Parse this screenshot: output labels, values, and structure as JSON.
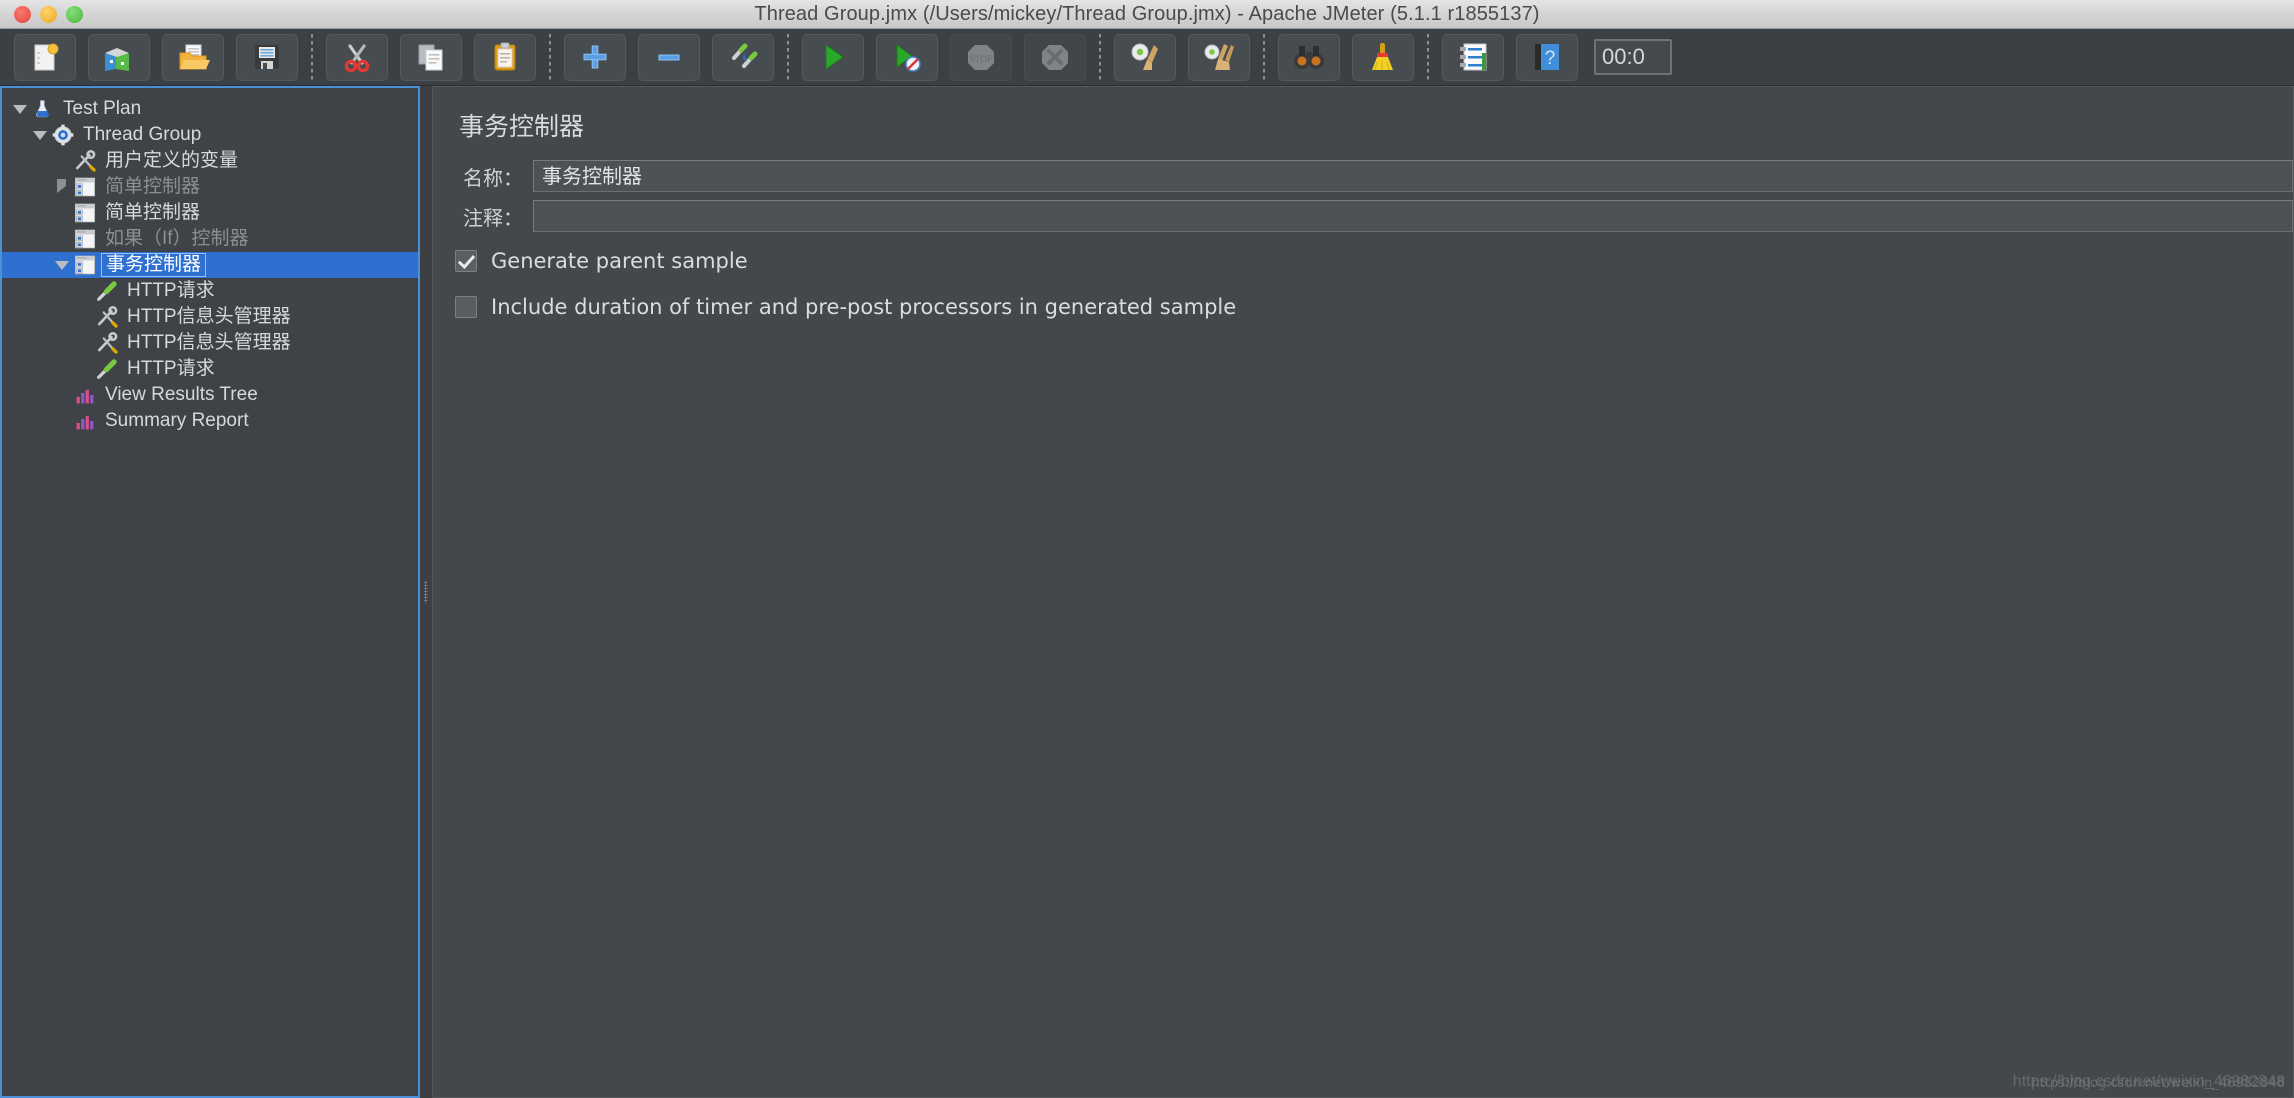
{
  "window": {
    "title": "Thread Group.jmx (/Users/mickey/Thread Group.jmx) - Apache JMeter (5.1.1 r1855137)",
    "traffic_lights": [
      "close",
      "minimize",
      "zoom"
    ]
  },
  "toolbar": {
    "timer": "00:0",
    "buttons": [
      {
        "name": "new-test-plan-button",
        "icon": "new-document-icon",
        "tooltip": "New",
        "enabled": true
      },
      {
        "name": "templates-button",
        "icon": "templates-books-icon",
        "tooltip": "Templates",
        "enabled": true
      },
      {
        "name": "open-button",
        "icon": "open-folder-icon",
        "tooltip": "Open",
        "enabled": true
      },
      {
        "name": "save-button",
        "icon": "floppy-disk-icon",
        "tooltip": "Save Test Plan",
        "enabled": true
      },
      {
        "name": "separator-1",
        "icon": "dotted-separator",
        "tooltip": "",
        "enabled": true
      },
      {
        "name": "cut-button",
        "icon": "scissors-icon",
        "tooltip": "Cut",
        "enabled": true
      },
      {
        "name": "copy-button",
        "icon": "copy-pages-icon",
        "tooltip": "Copy",
        "enabled": true
      },
      {
        "name": "paste-button",
        "icon": "clipboard-icon",
        "tooltip": "Paste",
        "enabled": true
      },
      {
        "name": "separator-2",
        "icon": "dotted-separator",
        "tooltip": "",
        "enabled": true
      },
      {
        "name": "expand-all-button",
        "icon": "plus-icon",
        "tooltip": "Expand All",
        "enabled": true
      },
      {
        "name": "collapse-all-button",
        "icon": "minus-icon",
        "tooltip": "Collapse All",
        "enabled": true
      },
      {
        "name": "toggle-button",
        "icon": "toggle-pencils-icon",
        "tooltip": "Toggle",
        "enabled": true
      },
      {
        "name": "separator-3",
        "icon": "dotted-separator",
        "tooltip": "",
        "enabled": true
      },
      {
        "name": "start-button",
        "icon": "green-play-icon",
        "tooltip": "Start",
        "enabled": true
      },
      {
        "name": "start-no-pauses-button",
        "icon": "green-play-no-pause-icon",
        "tooltip": "Start no pauses",
        "enabled": true
      },
      {
        "name": "stop-button",
        "icon": "stop-sign-icon",
        "tooltip": "Stop",
        "enabled": false
      },
      {
        "name": "shutdown-button",
        "icon": "shutdown-x-icon",
        "tooltip": "Shutdown",
        "enabled": false
      },
      {
        "name": "separator-4",
        "icon": "dotted-separator",
        "tooltip": "",
        "enabled": true
      },
      {
        "name": "clear-button",
        "icon": "gear-broom-icon",
        "tooltip": "Clear",
        "enabled": true
      },
      {
        "name": "clear-all-button",
        "icon": "gear-brooms-icon",
        "tooltip": "Clear All",
        "enabled": true
      },
      {
        "name": "separator-5",
        "icon": "dotted-separator",
        "tooltip": "",
        "enabled": true
      },
      {
        "name": "search-button",
        "icon": "binoculars-icon",
        "tooltip": "Search",
        "enabled": true
      },
      {
        "name": "reset-search-button",
        "icon": "yellow-broom-icon",
        "tooltip": "Reset Search",
        "enabled": true
      },
      {
        "name": "separator-6",
        "icon": "dotted-separator",
        "tooltip": "",
        "enabled": true
      },
      {
        "name": "function-helper-button",
        "icon": "function-list-icon",
        "tooltip": "Function Helper Dialog",
        "enabled": true
      },
      {
        "name": "help-button",
        "icon": "blue-help-book-icon",
        "tooltip": "Help",
        "enabled": true
      }
    ]
  },
  "tree": {
    "items": [
      {
        "label": "Test Plan",
        "icon": "flask-icon",
        "indent": 0,
        "twisty": "down",
        "selected": false,
        "dim": false
      },
      {
        "label": "Thread Group",
        "icon": "gear-thread-icon",
        "indent": 1,
        "twisty": "down",
        "selected": false,
        "dim": false
      },
      {
        "label": "用户定义的变量",
        "icon": "wrench-screwdriver-icon",
        "indent": 2,
        "twisty": "none",
        "selected": false,
        "dim": false
      },
      {
        "label": "简单控制器",
        "icon": "controller-icon",
        "indent": 2,
        "twisty": "right",
        "selected": false,
        "dim": true
      },
      {
        "label": "简单控制器",
        "icon": "controller-icon",
        "indent": 2,
        "twisty": "none",
        "selected": false,
        "dim": false
      },
      {
        "label": "如果（If）控制器",
        "icon": "controller-icon",
        "indent": 2,
        "twisty": "none",
        "selected": false,
        "dim": true
      },
      {
        "label": "事务控制器",
        "icon": "controller-icon",
        "indent": 2,
        "twisty": "down",
        "selected": true,
        "dim": false
      },
      {
        "label": "HTTP请求",
        "icon": "pipette-icon",
        "indent": 3,
        "twisty": "none",
        "selected": false,
        "dim": false
      },
      {
        "label": "HTTP信息头管理器",
        "icon": "wrench-screwdriver-icon",
        "indent": 3,
        "twisty": "none",
        "selected": false,
        "dim": false
      },
      {
        "label": "HTTP信息头管理器",
        "icon": "wrench-screwdriver-icon",
        "indent": 3,
        "twisty": "none",
        "selected": false,
        "dim": false
      },
      {
        "label": "HTTP请求",
        "icon": "pipette-icon",
        "indent": 3,
        "twisty": "none",
        "selected": false,
        "dim": false
      },
      {
        "label": "View Results Tree",
        "icon": "results-tree-icon",
        "indent": 2,
        "twisty": "none",
        "selected": false,
        "dim": false
      },
      {
        "label": "Summary Report",
        "icon": "results-tree-icon",
        "indent": 2,
        "twisty": "none",
        "selected": false,
        "dim": false
      }
    ]
  },
  "main": {
    "title": "事务控制器",
    "fields": [
      {
        "name": "name-field",
        "label": "名称：",
        "value": "事务控制器"
      },
      {
        "name": "comment-field",
        "label": "注释：",
        "value": ""
      }
    ],
    "checkboxes": [
      {
        "name": "generate-parent-sample-checkbox",
        "label": "Generate parent sample",
        "checked": true
      },
      {
        "name": "include-duration-checkbox",
        "label": "Include duration of timer and pre-post processors in generated sample",
        "checked": false
      }
    ]
  },
  "watermark": {
    "line1": "https://blog.csdn.net/weixin_46982848",
    "line2": "https://blog.csdn.net/weixin_46982848"
  }
}
